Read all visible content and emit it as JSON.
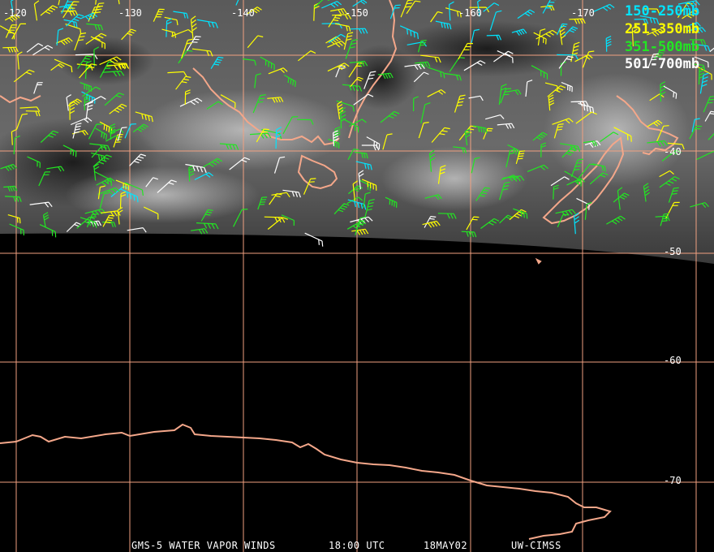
{
  "map": {
    "lon_labels": [
      "-120",
      "-130",
      "-140",
      "-150",
      "-160",
      "-170"
    ],
    "lat_labels": [
      "-40",
      "-50",
      "-60",
      "-70"
    ],
    "grid_color": "#f0a080",
    "coast_color": "#f4a78a",
    "imagery": "water vapor (grayscale)"
  },
  "legend": [
    {
      "label": "150-250mb",
      "color": "#00e5ff"
    },
    {
      "label": "251-350mb",
      "color": "#ffff00"
    },
    {
      "label": "351-500mb",
      "color": "#22e622"
    },
    {
      "label": "501-700mb",
      "color": "#ffffff"
    }
  ],
  "caption": {
    "satellite": "GMS-5 WATER VAPOR WINDS",
    "time": "18:00 UTC",
    "date": "18MAY02",
    "source": "UW-CIMSS"
  }
}
